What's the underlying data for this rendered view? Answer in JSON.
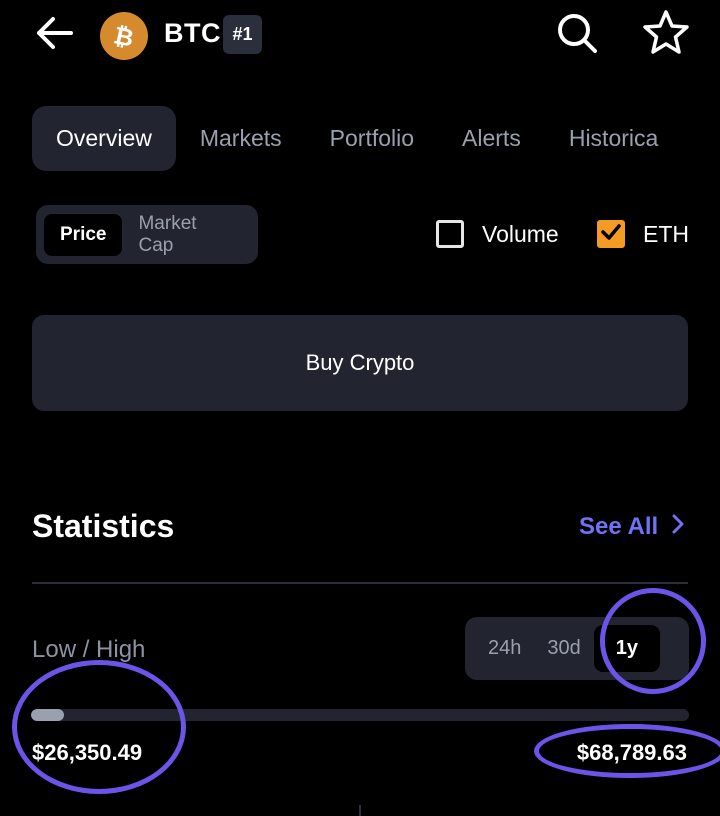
{
  "header": {
    "back_icon": "arrow-left-icon",
    "coin_icon": "bitcoin-logo-icon",
    "symbol": "BTC",
    "rank": "#1",
    "search_icon": "search-icon",
    "favorite_icon": "star-outline-icon"
  },
  "tabs": [
    {
      "label": "Overview",
      "active": true
    },
    {
      "label": "Markets",
      "active": false
    },
    {
      "label": "Portfolio",
      "active": false
    },
    {
      "label": "Alerts",
      "active": false
    },
    {
      "label": "Historica",
      "active": false
    }
  ],
  "chart_toggle": {
    "price": "Price",
    "market_cap": "Market Cap",
    "selected": "Price"
  },
  "overlays": {
    "volume": {
      "label": "Volume",
      "checked": false
    },
    "eth": {
      "label": "ETH",
      "checked": true
    }
  },
  "buy_button": "Buy Crypto",
  "statistics": {
    "title": "Statistics",
    "see_all": "See All",
    "low_high_label": "Low / High",
    "ranges": [
      "24h",
      "30d",
      "1y"
    ],
    "selected_range": "1y",
    "low": "$26,350.49",
    "high": "$68,789.63",
    "current_position_fraction": 0.05
  },
  "colors": {
    "background": "#000000",
    "surface": "#22242f",
    "accent": "#6e72f3",
    "checkbox_checked": "#f59a23",
    "coin_orange": "#d58a2e",
    "annotation": "#6a55e8"
  }
}
